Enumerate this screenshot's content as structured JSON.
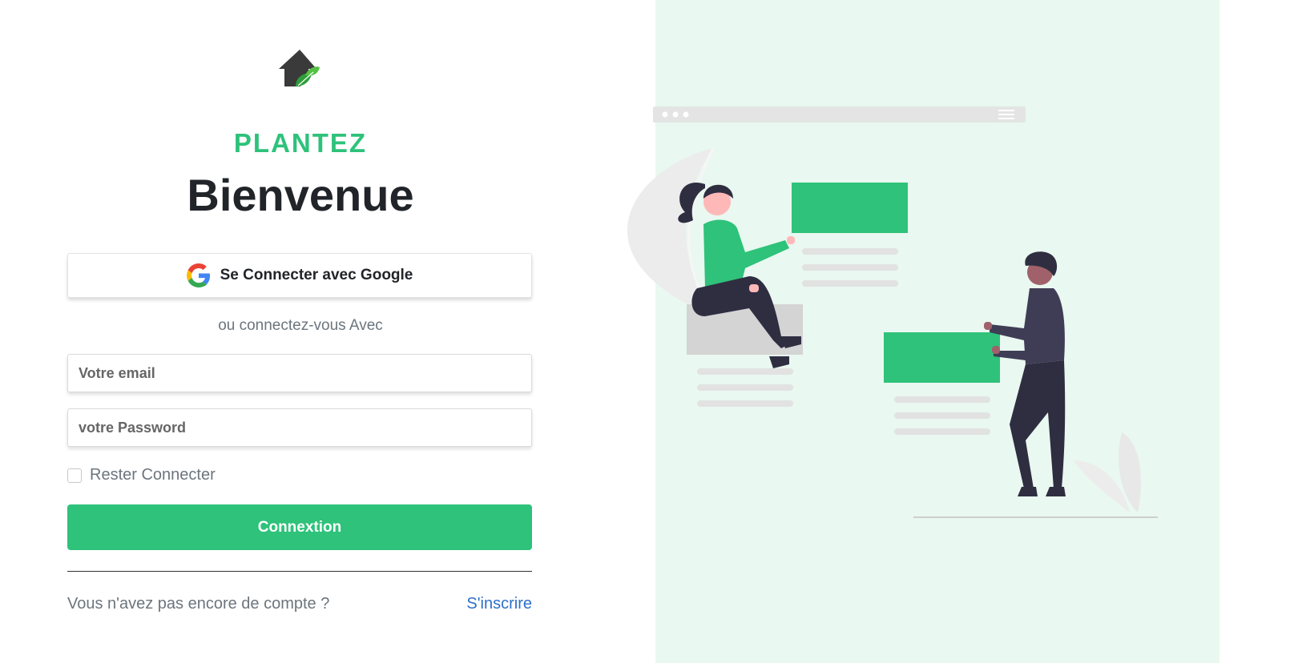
{
  "brand": {
    "name": "PLANTEZ"
  },
  "page": {
    "title": "Bienvenue"
  },
  "google": {
    "label": "Se Connecter avec Google"
  },
  "divider_text": "ou connectez-vous Avec",
  "form": {
    "email_placeholder": "Votre email",
    "password_placeholder": "votre Password",
    "remember_label": "Rester Connecter",
    "submit_label": "Connextion"
  },
  "footer": {
    "no_account": "Vous n'avez pas encore de compte ?",
    "signup_label": "S'inscrire"
  },
  "colors": {
    "accent": "#2ec27a",
    "link": "#2d6fc9",
    "panel_bg": "#e9f8f0"
  },
  "icons": {
    "logo": "house-leaf-icon",
    "google": "google-icon"
  }
}
